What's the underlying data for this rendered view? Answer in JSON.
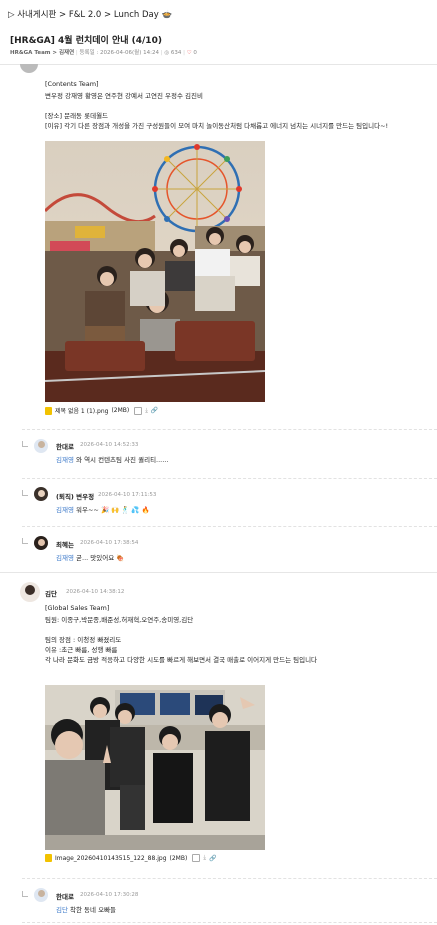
{
  "header": {
    "breadcrumb": "▷ 사내게시판 > F&L 2.0 > Lunch Day 🍲",
    "title": "[HR&GA] 4월 런치데이 안내 (4/10)",
    "meta_author": "HR&GA Team > 김재연",
    "meta_date": "등록일 : 2026-04-06(월) 14:24",
    "meta_views": "634",
    "meta_likes": "0"
  },
  "post1": {
    "lines": [
      "[Contents Team]",
      "변우정 강재영 황영은 연주현 강예서 고연진 우정수 김진비",
      "",
      "[장소] 문래동 롯데월드",
      "[이유] 각기 다른 장점과 개성을 가진 구성원들이 모여 마치 놀이동산처럼 다채롭고 에너지 넘치는 시너지를 만드는 팀입니다~!"
    ],
    "file": "제목 없음 1 (1).png",
    "file_size": "(2MB)"
  },
  "comments1": [
    {
      "name": "한대로",
      "date": "2026-04-10 14:52:33",
      "mention": "김재영",
      "text": " 와 역시 컨텐츠팀 사진 퀄리티......"
    },
    {
      "name": "(퇴직) 변우정",
      "date": "2026-04-10 17:11:53",
      "mention": "김재영",
      "text": " 워우~~ 🎉 🙌 🕺 💦 🔥"
    },
    {
      "name": "최혜는",
      "date": "2026-04-10 17:38:54",
      "mention": "김재영",
      "text": " 굳... 맛있어요 🍖"
    }
  ],
  "post2": {
    "name": "김단",
    "date": "2026-04-10 14:38:12",
    "lines": [
      "[Global Sales Team]",
      "팀원: 이종구,박문종,배준성,허재혁,오연주,송미영,김단",
      "",
      "팀의 장점 : 이청정 빠졌리도",
      "이유 :초근 빠름, 성행 빠름",
      "각 나라 문화도 금방 적응하고 다양한 시도를 빠르게 해보면서 결국 매출로 이어지게 만드는 팀입니다"
    ],
    "file": "Image_20260410143515_122_88.jpg",
    "file_size": "(2MB)"
  },
  "comments2": [
    {
      "name": "한대로",
      "date": "2026-04-10 17:30:28",
      "mention": "김단",
      "text": " 착한 동네 오빠들"
    }
  ],
  "colors": {
    "mention": "#3a78c9",
    "heart": "#e33333",
    "file_icon": "#f2c200"
  }
}
